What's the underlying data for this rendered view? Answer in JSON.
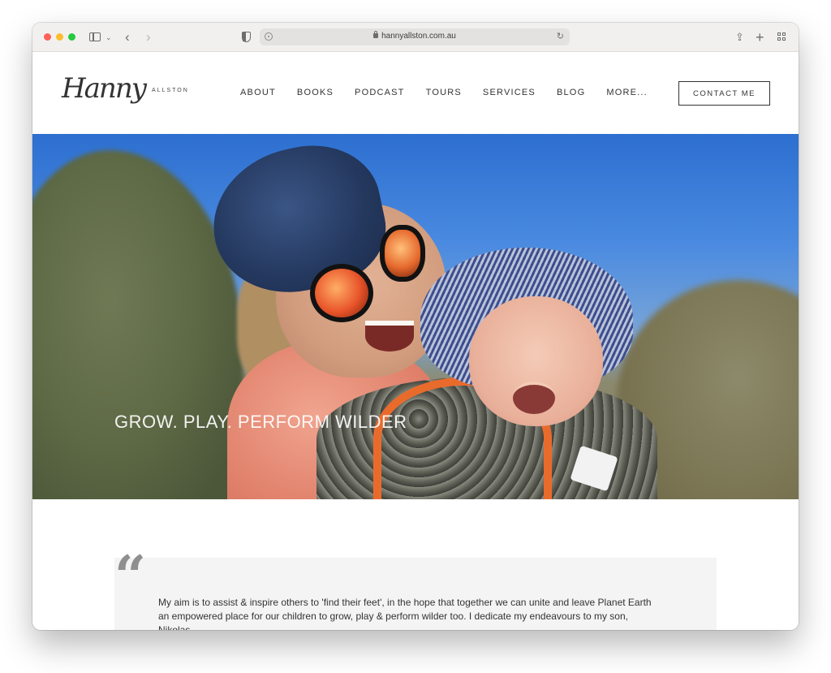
{
  "browser": {
    "url": "hannyallston.com.au"
  },
  "site": {
    "logo_script": "Hanny",
    "logo_surname": "ALLSTON",
    "nav": [
      "ABOUT",
      "BOOKS",
      "PODCAST",
      "TOURS",
      "SERVICES",
      "BLOG",
      "MORE..."
    ],
    "contact_label": "CONTACT ME"
  },
  "hero": {
    "title": "GROW. PLAY. PERFORM WILDER"
  },
  "quote": {
    "mark": "“",
    "text": "My aim is to assist & inspire others to 'find their feet', in the hope that together we can unite and leave Planet Earth an empowered place for our children to grow, play & perform wilder too. I dedicate my endeavours to my son, Nikolas..."
  },
  "icons": {
    "sidebar": "sidebar-icon",
    "back": "chevron-left-icon",
    "forward": "chevron-right-icon",
    "privacy": "shield-icon",
    "lock": "lock-icon",
    "reload": "reload-icon",
    "share": "share-icon",
    "new_tab": "plus-icon",
    "tab_overview": "tab-grid-icon"
  }
}
